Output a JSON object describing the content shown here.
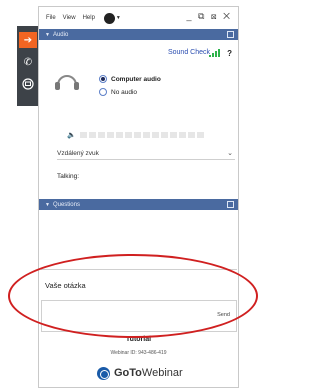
{
  "menu": {
    "file": "File",
    "view": "View",
    "help": "Help",
    "window_controls": "_ ⧉ ⊠ ✕"
  },
  "left_bar": {
    "items": [
      "arrow-right-icon",
      "phone-icon",
      "screen-icon"
    ],
    "accent": "#f26522"
  },
  "audio": {
    "header": "Audio",
    "sound_check": "Sound Check",
    "help": "?",
    "options": [
      "Computer audio",
      "No audio"
    ],
    "selected_option": "Computer audio",
    "speaker_select": "Vzdálený zvuk",
    "talking_label": "Talking:"
  },
  "questions": {
    "header": "Questions",
    "label": "Vaše otázka",
    "send": "Send"
  },
  "footer": {
    "title": "Tutorial",
    "webinar_id": "Webinar ID: 943-486-419",
    "brand_go": "GoTo",
    "brand_rest": "Webinar"
  },
  "colors": {
    "section_header": "#4a6aa0",
    "accent": "#f26522",
    "signal": "#2db34a",
    "annotation": "#d02020"
  }
}
